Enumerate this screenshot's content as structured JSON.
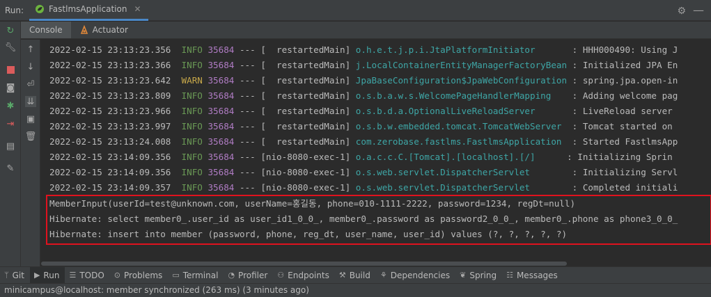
{
  "run_bar": {
    "label": "Run:",
    "tab_title": "FastlmsApplication",
    "tab_close": "✕",
    "settings_glyph": "⚙",
    "hide_glyph": "—"
  },
  "sub_tabs": {
    "console": "Console",
    "actuator": "Actuator"
  },
  "console_lines": [
    {
      "ts": "2022-02-15 23:13:23.356",
      "level": "INFO",
      "pid": "35684",
      "sep": "---",
      "thread": "[  restartedMain]",
      "logger": "o.h.e.t.j.p.i.JtaPlatformInitiator      ",
      "msg": " : HHH000490: Using J"
    },
    {
      "ts": "2022-02-15 23:13:23.366",
      "level": "INFO",
      "pid": "35684",
      "sep": "---",
      "thread": "[  restartedMain]",
      "logger": "j.LocalContainerEntityManagerFactoryBean",
      "msg": " : Initialized JPA En"
    },
    {
      "ts": "2022-02-15 23:13:23.642",
      "level": "WARN",
      "pid": "35684",
      "sep": "---",
      "thread": "[  restartedMain]",
      "logger": "JpaBaseConfiguration$JpaWebConfiguration",
      "msg": " : spring.jpa.open-in"
    },
    {
      "ts": "2022-02-15 23:13:23.809",
      "level": "INFO",
      "pid": "35684",
      "sep": "---",
      "thread": "[  restartedMain]",
      "logger": "o.s.b.a.w.s.WelcomePageHandlerMapping   ",
      "msg": " : Adding welcome pag"
    },
    {
      "ts": "2022-02-15 23:13:23.966",
      "level": "INFO",
      "pid": "35684",
      "sep": "---",
      "thread": "[  restartedMain]",
      "logger": "o.s.b.d.a.OptionalLiveReloadServer      ",
      "msg": " : LiveReload server"
    },
    {
      "ts": "2022-02-15 23:13:23.997",
      "level": "INFO",
      "pid": "35684",
      "sep": "---",
      "thread": "[  restartedMain]",
      "logger": "o.s.b.w.embedded.tomcat.TomcatWebServer ",
      "msg": " : Tomcat started on"
    },
    {
      "ts": "2022-02-15 23:13:24.008",
      "level": "INFO",
      "pid": "35684",
      "sep": "---",
      "thread": "[  restartedMain]",
      "logger": "com.zerobase.fastlms.FastlmsApplication ",
      "msg": " : Started FastlmsApp"
    },
    {
      "ts": "2022-02-15 23:14:09.356",
      "level": "INFO",
      "pid": "35684",
      "sep": "---",
      "thread": "[nio-8080-exec-1]",
      "logger": "o.a.c.c.C.[Tomcat].[localhost].[/]     ",
      "msg": " : Initializing Sprin"
    },
    {
      "ts": "2022-02-15 23:14:09.356",
      "level": "INFO",
      "pid": "35684",
      "sep": "---",
      "thread": "[nio-8080-exec-1]",
      "logger": "o.s.web.servlet.DispatcherServlet       ",
      "msg": " : Initializing Servl"
    },
    {
      "ts": "2022-02-15 23:14:09.357",
      "level": "INFO",
      "pid": "35684",
      "sep": "---",
      "thread": "[nio-8080-exec-1]",
      "logger": "o.s.web.servlet.DispatcherServlet       ",
      "msg": " : Completed initiali"
    }
  ],
  "plain_lines": [
    "MemberInput(userId=test@unknown.com, userName=홍길동, phone=010-1111-2222, password=1234, regDt=null)",
    "Hibernate: select member0_.user_id as user_id1_0_0_, member0_.password as password2_0_0_, member0_.phone as phone3_0_0_",
    "Hibernate: insert into member (password, phone, reg_dt, user_name, user_id) values (?, ?, ?, ?, ?)"
  ],
  "tool_windows": [
    {
      "label": "Git",
      "icon": "git-icon",
      "glyph": "ᛘ",
      "active": false
    },
    {
      "label": "Run",
      "icon": "run-icon",
      "glyph": "▶",
      "active": true
    },
    {
      "label": "TODO",
      "icon": "todo-icon",
      "glyph": "☰",
      "active": false
    },
    {
      "label": "Problems",
      "icon": "problems-icon",
      "glyph": "⊙",
      "active": false
    },
    {
      "label": "Terminal",
      "icon": "terminal-icon",
      "glyph": "▭",
      "active": false
    },
    {
      "label": "Profiler",
      "icon": "profiler-icon",
      "glyph": "◔",
      "active": false
    },
    {
      "label": "Endpoints",
      "icon": "endpoints-icon",
      "glyph": "⚇",
      "active": false
    },
    {
      "label": "Build",
      "icon": "build-icon",
      "glyph": "⚒",
      "active": false
    },
    {
      "label": "Dependencies",
      "icon": "dependencies-icon",
      "glyph": "⚘",
      "active": false
    },
    {
      "label": "Spring",
      "icon": "spring-icon",
      "glyph": "❦",
      "active": false
    },
    {
      "label": "Messages",
      "icon": "messages-icon",
      "glyph": "☷",
      "active": false
    }
  ],
  "status_bar": {
    "text": "minicampus@localhost: member synchronized (263 ms) (3 minutes ago)"
  },
  "colors": {
    "info": "#6a9955",
    "warn": "#c7a84a",
    "pid": "#b07cc4",
    "logger": "#3ea6a6",
    "highlight_border": "#e0121e"
  }
}
